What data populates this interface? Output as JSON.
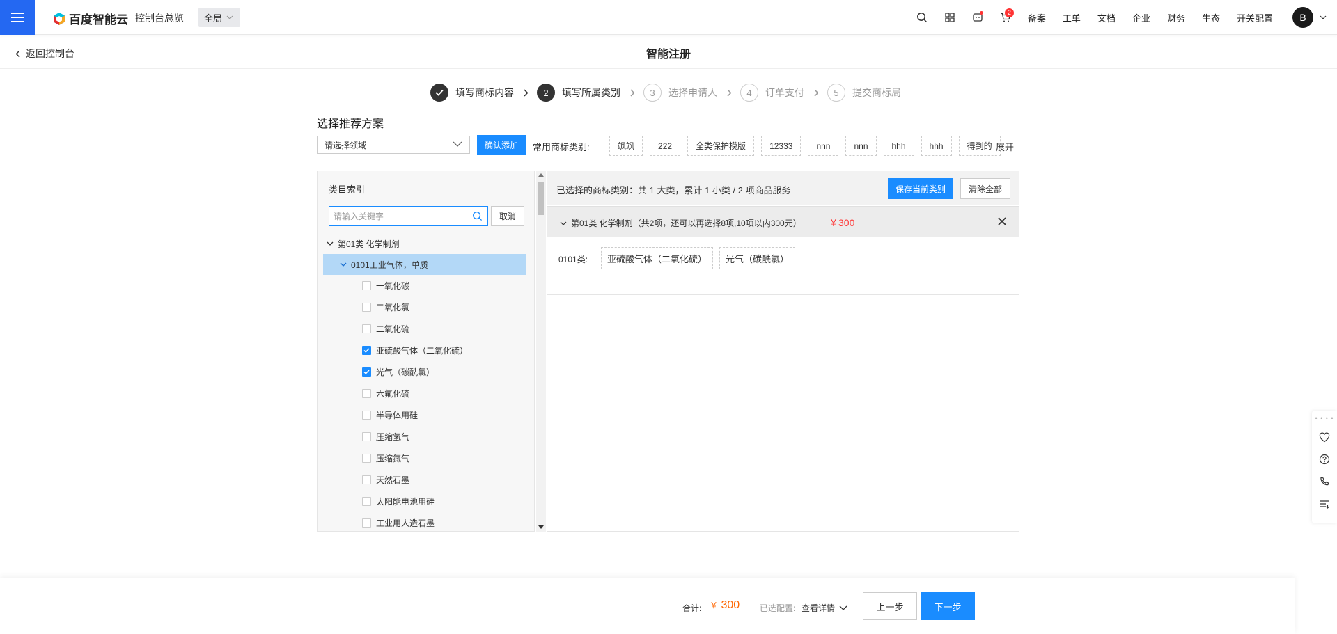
{
  "topnav": {
    "logo_text": "百度智能云",
    "overview": "控制台总览",
    "region": "全局",
    "cart_badge": "2",
    "links": [
      "备案",
      "工单",
      "文档",
      "企业",
      "财务",
      "生态",
      "开关配置"
    ],
    "avatar": "B"
  },
  "subheader": {
    "back": "返回控制台",
    "title": "智能注册"
  },
  "steps": [
    {
      "num": "✓",
      "label": "填写商标内容",
      "state": "done"
    },
    {
      "num": "2",
      "label": "填写所属类别",
      "state": "active"
    },
    {
      "num": "3",
      "label": "选择申请人",
      "state": "todo"
    },
    {
      "num": "4",
      "label": "订单支付",
      "state": "todo"
    },
    {
      "num": "5",
      "label": "提交商标局",
      "state": "todo"
    }
  ],
  "plan": {
    "title": "选择推荐方案",
    "domain_placeholder": "请选择领域",
    "confirm_add": "确认添加",
    "common_label": "常用商标类别:",
    "common_tags": [
      "飒飒",
      "222",
      "全类保护模版",
      "12333",
      "nnn",
      "nnn",
      "hhh",
      "hhh",
      "得到的"
    ],
    "expand": "展开"
  },
  "left": {
    "title": "类目索引",
    "search_placeholder": "请输入关键字",
    "cancel": "取消",
    "class_node": "第01类 化学制剂",
    "group_node": "0101工业气体，单质",
    "items": [
      {
        "label": "一氧化碳",
        "checked": false
      },
      {
        "label": "二氧化氯",
        "checked": false
      },
      {
        "label": "二氧化硫",
        "checked": false
      },
      {
        "label": "亚硫酸气体（二氧化硫）",
        "checked": true
      },
      {
        "label": "光气（碳酰氯）",
        "checked": true
      },
      {
        "label": "六氟化硫",
        "checked": false
      },
      {
        "label": "半导体用硅",
        "checked": false
      },
      {
        "label": "压缩氢气",
        "checked": false
      },
      {
        "label": "压缩氮气",
        "checked": false
      },
      {
        "label": "天然石墨",
        "checked": false
      },
      {
        "label": "太阳能电池用硅",
        "checked": false
      },
      {
        "label": "工业用人造石墨",
        "checked": false
      }
    ]
  },
  "right": {
    "summary": "已选择的商标类别：共 1 大类，累计 1 小类 / 2 项商品服务",
    "save": "保存当前类别",
    "clear": "清除全部",
    "class_label": "第01类 化学制剂（共2项，还可以再选择8项,10项以内300元）",
    "class_price": "￥300",
    "goods_code": "0101类:",
    "goods": [
      "亚硫酸气体（二氧化硫）",
      "光气（碳酰氯）"
    ]
  },
  "bottom": {
    "total_label": "合计:",
    "total_currency": "￥",
    "total_value": "300",
    "config_label": "已选配置:",
    "config_link": "查看详情",
    "prev": "上一步",
    "next": "下一步"
  },
  "colors": {
    "primary": "#1a8cff",
    "menu_blue": "#2468f2",
    "price_red": "#f33",
    "total_orange": "#f60",
    "selected_row": "#b3d8f7"
  }
}
